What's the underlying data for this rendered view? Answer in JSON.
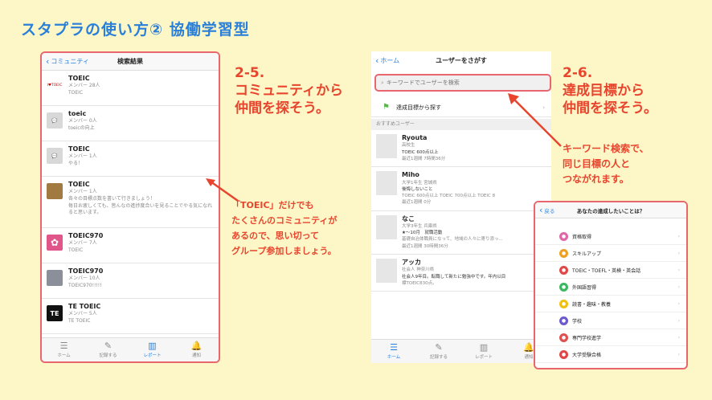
{
  "slide_title": "スタプラの使い方② 協働学習型",
  "left_phone": {
    "back_label": "コミュニティ",
    "title": "検索結果",
    "items": [
      {
        "name": "TOEIC",
        "line1": "メンバー 28人",
        "line2": "TOEIC",
        "line3": "",
        "thumb": "I ♥ TOEIC",
        "thumb_color": "#ffffff"
      },
      {
        "name": "toeic",
        "line1": "メンバー 0人",
        "line2": "toeicの向上",
        "line3": "",
        "thumb": "chat",
        "thumb_color": "#d8d8d8"
      },
      {
        "name": "TOEIC",
        "line1": "メンバー 1人",
        "line2": "やる！",
        "line3": "",
        "thumb": "chat",
        "thumb_color": "#d8d8d8"
      },
      {
        "name": "TOEIC",
        "line1": "メンバー 1人",
        "line2": "各々の目標点数を書いて行きましょう！",
        "line3": "毎日お疲しくても、皆んなの進捗度合いを見ることでやる気になれると思います。",
        "thumb": "photo",
        "thumb_color": "#a07a40"
      },
      {
        "name": "TOEIC970",
        "line1": "メンバー 7人",
        "line2": "TOEIC",
        "line3": "",
        "thumb": "flower",
        "thumb_color": "#e0558a"
      },
      {
        "name": "TOEIC970",
        "line1": "メンバー 10人",
        "line2": "TOEIC970!!!!!",
        "line3": "",
        "thumb": "photo",
        "thumb_color": "#8a8f9a"
      },
      {
        "name": "TE TOEIC",
        "line1": "メンバー 5人",
        "line2": "TE TOEIC",
        "line3": "",
        "thumb": "TE",
        "thumb_color": "#111111"
      }
    ],
    "tabs": [
      {
        "label": "ホーム",
        "icon": "list-icon"
      },
      {
        "label": "記録する",
        "icon": "pencil-icon"
      },
      {
        "label": "レポート",
        "icon": "chart-icon"
      },
      {
        "label": "通知",
        "icon": "bell-icon"
      }
    ]
  },
  "caption_25": {
    "number": "2-5.",
    "lines": [
      "コミュニティから",
      "仲間を探そう。"
    ]
  },
  "caption_toeic": {
    "lines": [
      "「TOEIC」だけでも",
      "たくさんのコミュニティが",
      "あるので、思い切って",
      "グループ参加しましょう。"
    ]
  },
  "right_phone": {
    "back_label": "ホーム",
    "title": "ユーザーをさがす",
    "search_placeholder": "キーワードでユーザーを検索",
    "goal_row_label": "達成目標から探す",
    "section_label": "おすすめユーザー",
    "users": [
      {
        "name": "Ryouta",
        "line1": "高校生",
        "line2": "TOEIC 600点以上",
        "line3": "最近1週間 7時間36分",
        "bio": ""
      },
      {
        "name": "Miho",
        "line1": "大学1年生 宮城県",
        "line2": "後悔しないこと",
        "line3": "TOEIC 600点以上  TOEIC 700点以上  TOEIC 8",
        "bio": "最近1週間 0分"
      },
      {
        "name": "なこ",
        "line1": "大学3年生 兵庫県",
        "line2": "★〜10月　就職活動",
        "line3": "基礎自治体職員になって、地域の人々に寄り添っ...",
        "bio": "最近1週間 30時間36分"
      },
      {
        "name": "アッカ",
        "line1": "社会人 神奈川県",
        "line2": "社会人9年目。転職して新たに勉強中です。年内以目",
        "line3": "標TOEIC830点。",
        "bio": ""
      }
    ],
    "tabs": [
      {
        "label": "ホーム",
        "icon": "list-icon"
      },
      {
        "label": "記録する",
        "icon": "pencil-icon"
      },
      {
        "label": "レポート",
        "icon": "chart-icon"
      },
      {
        "label": "通知",
        "icon": "bell-icon"
      }
    ]
  },
  "caption_26": {
    "number": "2-6.",
    "lines": [
      "達成目標から",
      "仲間を探そう。"
    ]
  },
  "caption_keyword": {
    "lines": [
      "キーワード検索で、",
      "同じ目標の人と",
      "つながれます。"
    ]
  },
  "goal_popup": {
    "back_label": "戻る",
    "title": "あなたの達成したいことは？",
    "items": [
      {
        "label": "資格取得",
        "color": "#e066a8"
      },
      {
        "label": "スキルアップ",
        "color": "#f0a020"
      },
      {
        "label": "TOEIC・TOEFL・英検・英会話",
        "color": "#e04848"
      },
      {
        "label": "外国語習得",
        "color": "#3cb860"
      },
      {
        "label": "読書・趣味・教養",
        "color": "#f0c010"
      },
      {
        "label": "学校",
        "color": "#6a5acd"
      },
      {
        "label": "専門学校進学",
        "color": "#e05050"
      },
      {
        "label": "大学受験合格",
        "color": "#e04848"
      }
    ]
  }
}
